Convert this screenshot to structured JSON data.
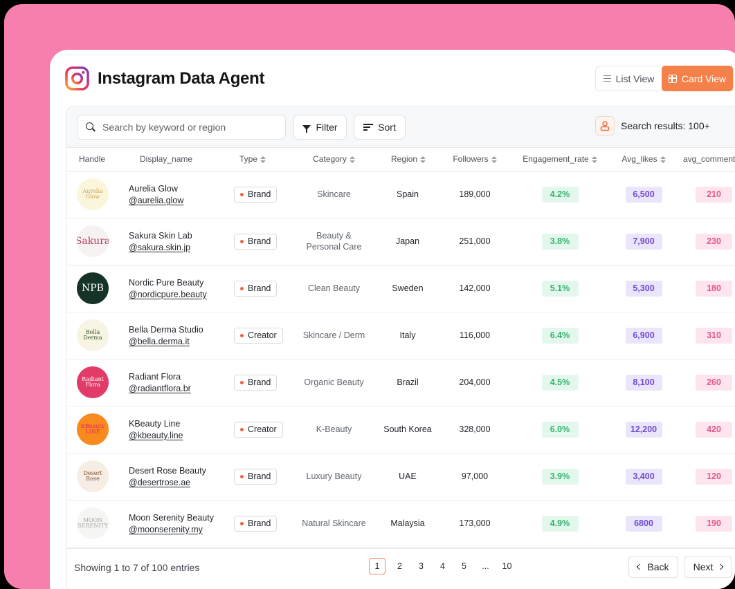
{
  "app": {
    "title": "Instagram Data Agent"
  },
  "view_toggle": {
    "list_label": "List View",
    "card_label": "Card View",
    "active": "Card View"
  },
  "toolbar": {
    "search_placeholder": "Search by keyword or region",
    "filter_label": "Filter",
    "sort_label": "Sort",
    "results_text": "Search results: 100+"
  },
  "table": {
    "columns": [
      "Handle",
      "Display_name",
      "Type",
      "Category",
      "Region",
      "Followers",
      "Engagement_rate",
      "Avg_likes",
      "avg_comments"
    ],
    "rows": [
      {
        "avatar_text": "Aurelia Glow",
        "avatar_bg": "#fbf5dc",
        "avatar_fg": "#c9a456",
        "name": "Aurelia Glow",
        "handle": "@aurelia.glow",
        "type": "Brand",
        "category": "Skincare",
        "region": "Spain",
        "followers": "189,000",
        "engagement": "4.2%",
        "likes": "6,500",
        "comments": "210"
      },
      {
        "avatar_text": "Sakura",
        "avatar_bg": "#f6f2f2",
        "avatar_fg": "#b0405a",
        "name": "Sakura Skin Lab",
        "handle": "@sakura.skin.jp",
        "type": "Brand",
        "category": "Beauty & Personal Care",
        "region": "Japan",
        "followers": "251,000",
        "engagement": "3.8%",
        "likes": "7,900",
        "comments": "230"
      },
      {
        "avatar_text": "NPB",
        "avatar_bg": "#163327",
        "avatar_fg": "#ffffff",
        "name": "Nordic Pure Beauty",
        "handle": "@nordicpure.beauty",
        "type": "Brand",
        "category": "Clean Beauty",
        "region": "Sweden",
        "followers": "142,000",
        "engagement": "5.1%",
        "likes": "5,300",
        "comments": "180"
      },
      {
        "avatar_text": "Bella Derma",
        "avatar_bg": "#f8f4e4",
        "avatar_fg": "#3d5a2a",
        "name": "Bella Derma Studio",
        "handle": "@bella.derma.it",
        "type": "Creator",
        "category": "Skincare / Derm",
        "region": "Italy",
        "followers": "116,000",
        "engagement": "6.4%",
        "likes": "6,900",
        "comments": "310"
      },
      {
        "avatar_text": "Radiant Flora",
        "avatar_bg": "#e23b68",
        "avatar_fg": "#ffffff",
        "name": "Radiant Flora",
        "handle": "@radiantflora.br",
        "type": "Brand",
        "category": "Organic Beauty",
        "region": "Brazil",
        "followers": "204,000",
        "engagement": "4.5%",
        "likes": "8,100",
        "comments": "260"
      },
      {
        "avatar_text": "KBeauty LINE",
        "avatar_bg": "#f98a1d",
        "avatar_fg": "#e0285e",
        "name": "KBeauty Line",
        "handle": "@kbeauty.line",
        "type": "Creator",
        "category": "K-Beauty",
        "region": "South Korea",
        "followers": "328,000",
        "engagement": "6.0%",
        "likes": "12,200",
        "comments": "420"
      },
      {
        "avatar_text": "Desert Rose",
        "avatar_bg": "#f6eee4",
        "avatar_fg": "#7b4a2c",
        "name": "Desert Rose Beauty",
        "handle": "@desertrose.ae",
        "type": "Brand",
        "category": "Luxury Beauty",
        "region": "UAE",
        "followers": "97,000",
        "engagement": "3.9%",
        "likes": "3,400",
        "comments": "120"
      },
      {
        "avatar_text": "MOON SERENITY",
        "avatar_bg": "#f5f5f3",
        "avatar_fg": "#a9a9a2",
        "name": "Moon Serenity Beauty",
        "handle": "@moonserenity.my",
        "type": "Brand",
        "category": "Natural Skincare",
        "region": "Malaysia",
        "followers": "173,000",
        "engagement": "4.9%",
        "likes": "6800",
        "comments": "190"
      }
    ]
  },
  "footer": {
    "entries_text": "Showing 1 to 7 of 100 entries",
    "pages": [
      "1",
      "2",
      "3",
      "4",
      "5",
      "...",
      "10"
    ],
    "active_page": "1",
    "back_label": "Back",
    "next_label": "Next"
  },
  "colors": {
    "background": "#f67fad",
    "accent": "#f4804a",
    "engagement_bg": "#e4f7ec",
    "likes_bg": "#ebe5fb",
    "comments_bg": "#fde4ee"
  }
}
